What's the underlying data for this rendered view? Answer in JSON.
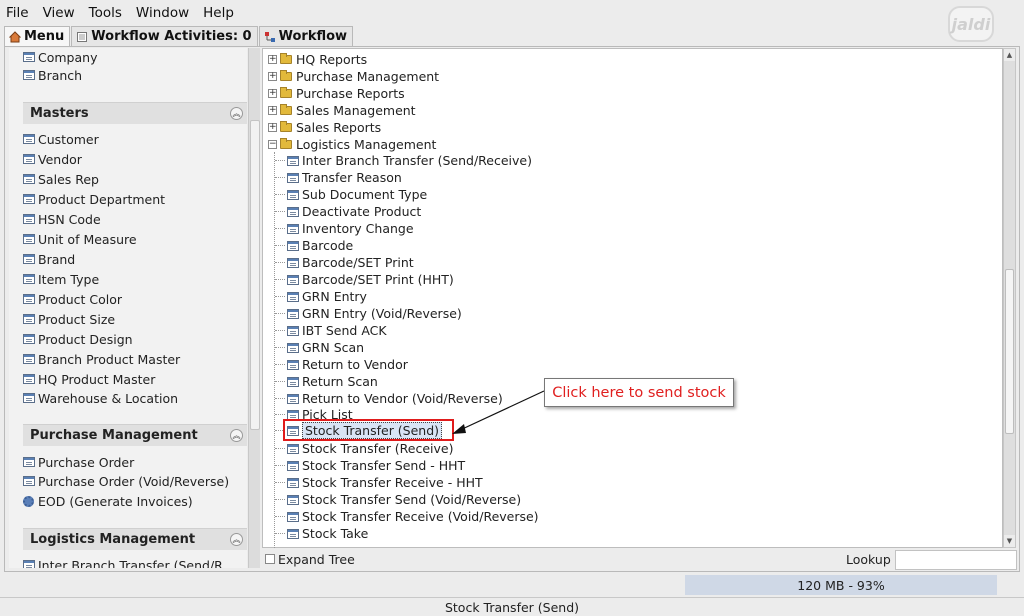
{
  "menubar": [
    "File",
    "View",
    "Tools",
    "Window",
    "Help"
  ],
  "logo": "jaldi",
  "tabs": [
    {
      "label": "Menu"
    },
    {
      "label": "Workflow Activities: 0"
    },
    {
      "label": "Workflow"
    }
  ],
  "left_panel": {
    "top_items": [
      "Company",
      "Branch"
    ],
    "masters": {
      "title": "Masters",
      "items": [
        "Customer",
        "Vendor",
        "Sales Rep",
        "Product Department",
        "HSN Code",
        "Unit of Measure",
        "Brand",
        "Item Type",
        "Product Color",
        "Product Size",
        "Product Design",
        "Branch Product Master",
        "HQ Product Master",
        "Warehouse & Location"
      ]
    },
    "purchase": {
      "title": "Purchase Management",
      "items": [
        "Purchase Order",
        "Purchase Order (Void/Reverse)",
        "EOD (Generate Invoices)"
      ]
    },
    "logistics": {
      "title": "Logistics Management",
      "items": [
        "Inter Branch Transfer (Send/R"
      ]
    }
  },
  "tree": {
    "folders": [
      "HQ Reports",
      "Purchase Management",
      "Purchase Reports",
      "Sales Management",
      "Sales Reports"
    ],
    "open_folder": "Logistics Management",
    "children": [
      "Inter Branch Transfer (Send/Receive)",
      "Transfer Reason",
      "Sub Document Type",
      "Deactivate Product",
      "Inventory Change",
      "Barcode",
      "Barcode/SET Print",
      "Barcode/SET Print (HHT)",
      "GRN Entry",
      "GRN Entry (Void/Reverse)",
      "IBT Send ACK",
      "GRN Scan",
      "Return to Vendor",
      "Return Scan",
      "Return to Vendor (Void/Reverse)",
      "Pick List",
      "Stock Transfer (Send)",
      "Stock Transfer (Receive)",
      "Stock Transfer Send - HHT",
      "Stock Transfer Receive - HHT",
      "Stock Transfer Send (Void/Reverse)",
      "Stock Transfer Receive (Void/Reverse)",
      "Stock Take"
    ],
    "selected": "Stock Transfer (Send)"
  },
  "callout": "Click here to send stock",
  "bottom": {
    "expand_tree": "Expand Tree",
    "lookup": "Lookup",
    "lookup_value": ""
  },
  "memory": "120 MB - 93%",
  "memory_fraction": 0.93,
  "status": "Stock Transfer (Send)",
  "colors": {
    "accent": "#e01b1b",
    "selection": "#d9e4f5",
    "memory_bar": "#cfd8e6"
  }
}
